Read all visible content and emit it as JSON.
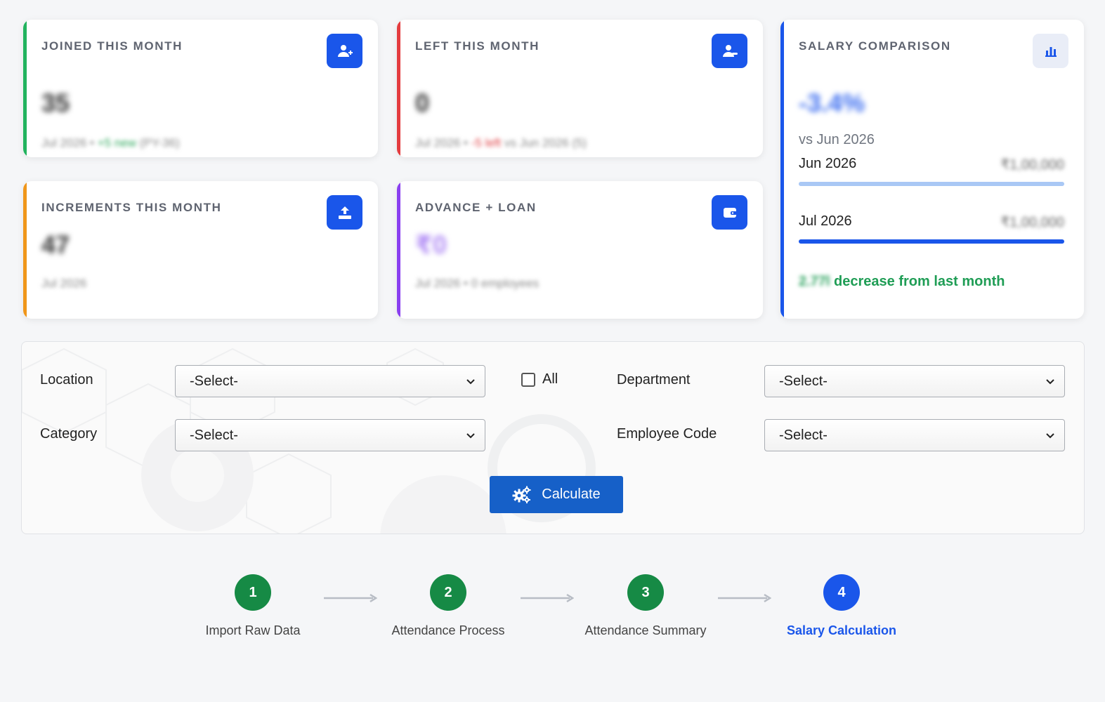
{
  "cards": {
    "joined": {
      "title": "JOINED THIS MONTH",
      "value": "35",
      "sub_period": "Jul 2026",
      "sub_sep": "•",
      "sub_change": "+5 new",
      "sub_rest": "(PY-36)",
      "accent": "#22b35e",
      "icon": "user-plus-icon"
    },
    "left": {
      "title": "LEFT THIS MONTH",
      "value": "0",
      "sub_period": "Jul 2026",
      "sub_sep": "•",
      "sub_change": "-5 left",
      "sub_rest": "vs Jun 2026 (5)",
      "accent": "#e43c3f",
      "icon": "user-minus-icon"
    },
    "increments": {
      "title": "INCREMENTS THIS MONTH",
      "value": "47",
      "sub_period": "Jul 2026",
      "accent": "#f0961a",
      "icon": "upload-icon"
    },
    "advance": {
      "title": "ADVANCE + LOAN",
      "value": "₹0",
      "sub_period": "Jul 2026",
      "sub_sep": "•",
      "sub_rest": "0 employees",
      "accent": "#8a3ff0",
      "value_color": "#b18cf5",
      "icon": "wallet-icon"
    },
    "salary": {
      "title": "SALARY COMPARISON",
      "value": "-3.4%",
      "vs": "vs Jun 2026",
      "rows": [
        {
          "label": "Jun 2026",
          "amount": "₹1,00,000",
          "fill": 1.0,
          "color": "#a9c8f5"
        },
        {
          "label": "Jul 2026",
          "amount": "₹1,00,000",
          "fill": 1.0,
          "color": "#1a56ea"
        }
      ],
      "note_amount": "2.77l",
      "note_text": "decrease from last month",
      "accent": "#1a56ea",
      "icon": "bar-chart-icon"
    }
  },
  "filters": {
    "location_label": "Location",
    "location_value": "-Select-",
    "all_label": "All",
    "department_label": "Department",
    "department_value": "-Select-",
    "category_label": "Category",
    "category_value": "-Select-",
    "employee_code_label": "Employee Code",
    "employee_code_value": "-Select-",
    "calculate_label": "Calculate"
  },
  "steps": [
    {
      "number": "1",
      "label": "Import Raw Data",
      "status": "done",
      "color": "#168a45"
    },
    {
      "number": "2",
      "label": "Attendance Process",
      "status": "done",
      "color": "#168a45"
    },
    {
      "number": "3",
      "label": "Attendance Summary",
      "status": "done",
      "color": "#168a45"
    },
    {
      "number": "4",
      "label": "Salary Calculation",
      "status": "active",
      "color": "#1a56ea"
    }
  ]
}
